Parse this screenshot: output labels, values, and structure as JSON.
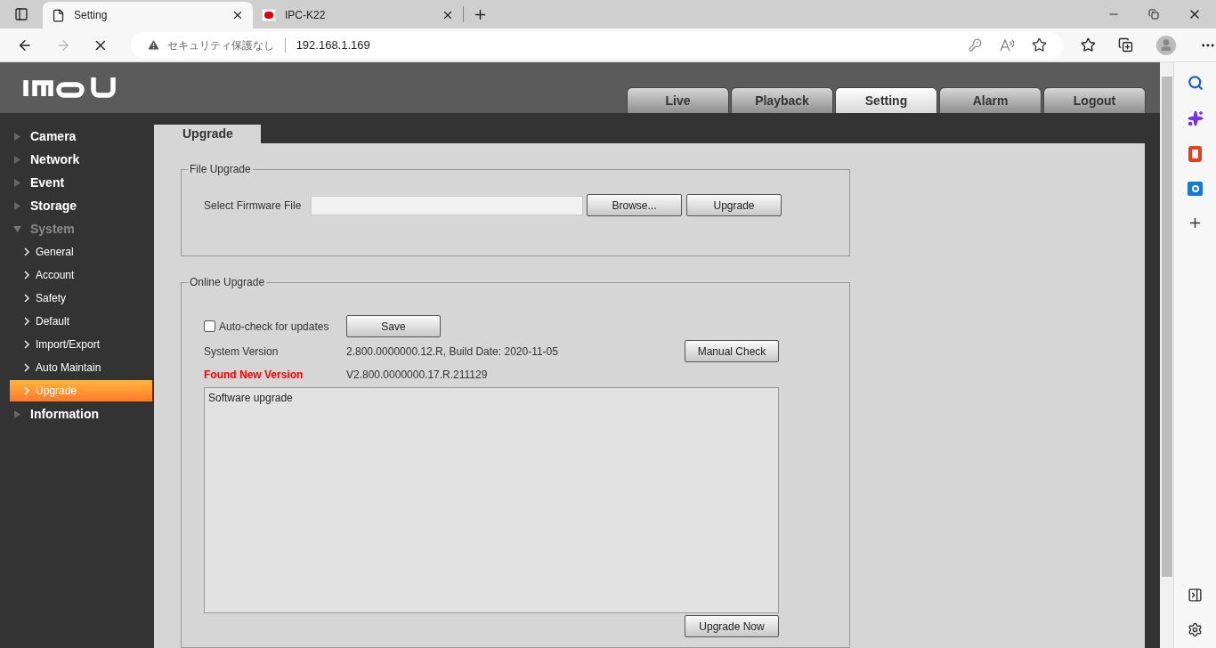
{
  "browser": {
    "tabs": [
      {
        "title": "Setting",
        "selected": true,
        "kind": "page"
      },
      {
        "title": "IPC-K22",
        "selected": false,
        "kind": "site"
      }
    ],
    "security_label": "セキュリティ保護なし",
    "address": "192.168.1.169"
  },
  "header": {
    "nav_tabs": [
      {
        "label": "Live",
        "selected": false
      },
      {
        "label": "Playback",
        "selected": false
      },
      {
        "label": "Setting",
        "selected": true
      },
      {
        "label": "Alarm",
        "selected": false
      },
      {
        "label": "Logout",
        "selected": false
      }
    ]
  },
  "sidebar": {
    "items": [
      {
        "label": "Camera",
        "expanded": false
      },
      {
        "label": "Network",
        "expanded": false
      },
      {
        "label": "Event",
        "expanded": false
      },
      {
        "label": "Storage",
        "expanded": false
      },
      {
        "label": "System",
        "expanded": true,
        "children": [
          {
            "label": "General",
            "selected": false
          },
          {
            "label": "Account",
            "selected": false
          },
          {
            "label": "Safety",
            "selected": false
          },
          {
            "label": "Default",
            "selected": false
          },
          {
            "label": "Import/Export",
            "selected": false
          },
          {
            "label": "Auto Maintain",
            "selected": false
          },
          {
            "label": "Upgrade",
            "selected": true
          }
        ]
      },
      {
        "label": "Information",
        "expanded": false
      }
    ]
  },
  "page_tab": "Upgrade",
  "file_upgrade": {
    "legend": "File Upgrade",
    "label": "Select Firmware File",
    "browse_button": "Browse...",
    "upgrade_button": "Upgrade"
  },
  "online_upgrade": {
    "legend": "Online Upgrade",
    "auto_check": {
      "label": "Auto-check for updates",
      "checked": false
    },
    "save_button": "Save",
    "system_version_label": "System Version",
    "system_version": "2.800.0000000.12.R, Build Date: 2020-11-05",
    "manual_check_button": "Manual Check",
    "new_version_label": "Found New Version",
    "new_version": "V2.800.0000000.17.R.211129",
    "notes": "Software upgrade",
    "upgrade_now_button": "Upgrade Now"
  }
}
